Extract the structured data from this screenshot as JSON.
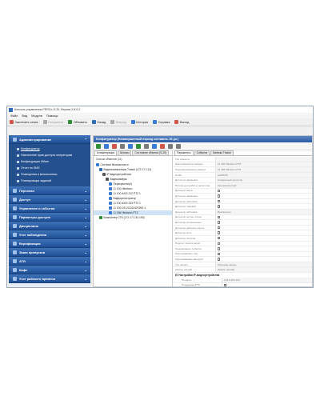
{
  "window": {
    "title": "Консоль управления PERCo-S-20, Версия 3.8.0.2"
  },
  "menu": [
    "Файл",
    "Вид",
    "Модули",
    "Помощь"
  ],
  "toolbar": [
    {
      "label": "Закончить сеанс",
      "color": "#d0564a",
      "enabled": true
    },
    {
      "label": "Сохранить",
      "color": "#a9a9a9",
      "enabled": false
    },
    {
      "label": "Обновить",
      "color": "#2f8f3a",
      "enabled": true
    },
    {
      "label": "Назад",
      "color": "#2f6db5",
      "enabled": true
    },
    {
      "label": "Вперед",
      "color": "#a9a9a9",
      "enabled": false
    },
    {
      "label": "История",
      "color": "#3a7bd5",
      "enabled": true
    },
    {
      "label": "Справка",
      "color": "#3a7bd5",
      "enabled": true
    },
    {
      "label": "Выход",
      "color": "#d0564a",
      "enabled": true
    }
  ],
  "sidebar": {
    "admin": {
      "label": "Администрирование",
      "items": [
        {
          "label": "Конфигуратор",
          "active": true
        },
        {
          "label": "Назначение прав доступа операторам",
          "active": false
        },
        {
          "label": "Конфигурация Mifare",
          "active": false
        },
        {
          "label": "Отчет по SMS",
          "active": false
        },
        {
          "label": "Помещения и мнемосхемы",
          "active": false
        },
        {
          "label": "Планировщик заданий",
          "active": false
        }
      ]
    },
    "sections": [
      "Персонал",
      "Доступ",
      "Управление и события",
      "Параметры доступа",
      "Дисциплина",
      "Учет наблюдения",
      "Верификация",
      "Заказ пропусков",
      "АТИ",
      "Кафе",
      "Учет рабочего времени"
    ]
  },
  "content": {
    "title": "Конфигуратор (Незавершенный период составить 30 дн.)",
    "left_tabs": [
      "Конфигурация",
      "Шлюзы",
      "Состояние объекта (S-20)"
    ],
    "filter_label": "Список объектов (11)",
    "tree": [
      {
        "label": "Система безопасности",
        "depth": 0,
        "color": "#3a7bd5",
        "selected": false
      },
      {
        "label": "Видеокомпьютеры Trassir (172.17.1.11)",
        "depth": 1,
        "color": "#2f6db5",
        "selected": false
      },
      {
        "label": "IP-видеоустройства",
        "depth": 2,
        "color": "#555555",
        "selected": false
      },
      {
        "label": "Видеокамеры",
        "depth": 3,
        "color": "#555555",
        "selected": false
      },
      {
        "label": "Перекрестки(4)",
        "depth": 4,
        "color": "#3a7bd5",
        "selected": false
      },
      {
        "label": "11 100 Hikvision",
        "depth": 4,
        "color": "#3a7bd5",
        "selected": false
      },
      {
        "label": "11 100 AXIS 212 PTZ 1",
        "depth": 4,
        "color": "#3a7bd5",
        "selected": false
      },
      {
        "label": "Видеорегистратор",
        "depth": 4,
        "color": "#3a7bd5",
        "selected": false
      },
      {
        "label": "11 100 AXIS 233 PTZ 1",
        "depth": 4,
        "color": "#3a7bd5",
        "selected": false
      },
      {
        "label": "11 100 DS-2CD2442FWD 1",
        "depth": 4,
        "color": "#3a7bd5",
        "selected": false
      },
      {
        "label": "11 156 Hikvision PTZ",
        "depth": 4,
        "color": "#3a7bd5",
        "selected": true
      },
      {
        "label": "Компьютер СТК (172.17.1.81.190)",
        "depth": 1,
        "color": "#2f8f3a",
        "selected": false
      }
    ],
    "right_tabs": [
      "Параметры",
      "События",
      "Каналы Trassir"
    ],
    "properties": [
      {
        "name": "Тип объекта",
        "value": "",
        "kind": "text"
      },
      {
        "name": "Идентификатор камеры",
        "value": "11 156 Hikvision PTZ",
        "kind": "text"
      },
      {
        "name": "Переименованная камера",
        "value": "11 156 Hikvision PTZ",
        "kind": "text"
      },
      {
        "name": "GUID",
        "value": "a1d55f7b",
        "kind": "text"
      },
      {
        "name": "Детектор движения",
        "value": "Аппаратный детектор",
        "kind": "text"
      },
      {
        "name": "Потеря для работы детектора",
        "value": "Автоматический",
        "kind": "text"
      },
      {
        "name": "Детектор звука",
        "value": "",
        "kind": "check"
      },
      {
        "name": "Детектор движения",
        "value": "",
        "kind": "check"
      },
      {
        "name": "Детектор саботажа",
        "value": "",
        "kind": "check"
      },
      {
        "name": "Детектор лицевой",
        "value": "",
        "kind": "check"
      },
      {
        "name": "Детектор саботажа",
        "value": "Выключено",
        "kind": "text"
      },
      {
        "name": "Детектор пустых полос",
        "value": "",
        "kind": "check"
      },
      {
        "name": "Детектор оставленных",
        "value": "",
        "kind": "check"
      },
      {
        "name": "Детектор рабочего места",
        "value": "",
        "kind": "check"
      },
      {
        "name": "Детектор коло",
        "value": "",
        "kind": "check"
      },
      {
        "name": "Детектор сигнала",
        "value": "",
        "kind": "check"
      },
      {
        "name": "Подсчет посетителей",
        "value": "",
        "kind": "check"
      },
      {
        "name": "Генерировать события",
        "value": "",
        "kind": "check"
      },
      {
        "name": "Распознавание лиц",
        "value": "",
        "kind": "check"
      },
      {
        "name": "Распознавание автомоб",
        "value": "",
        "kind": "check"
      },
      {
        "name": "Тип записи",
        "value": "Обычная запись",
        "kind": "text"
      },
      {
        "name": "Запись архива",
        "value": "Запись архива",
        "kind": "text"
      }
    ],
    "group": {
      "label": "Настройки IP-видеоустройства",
      "rows": [
        {
          "name": "IP-адрес",
          "value": "192.8.100.104",
          "kind": "text"
        },
        {
          "name": "Поддержка PTZ",
          "value": "✓",
          "kind": "check"
        }
      ]
    },
    "extra_groups": [
      "Основной поток",
      "Субпоток"
    ]
  }
}
